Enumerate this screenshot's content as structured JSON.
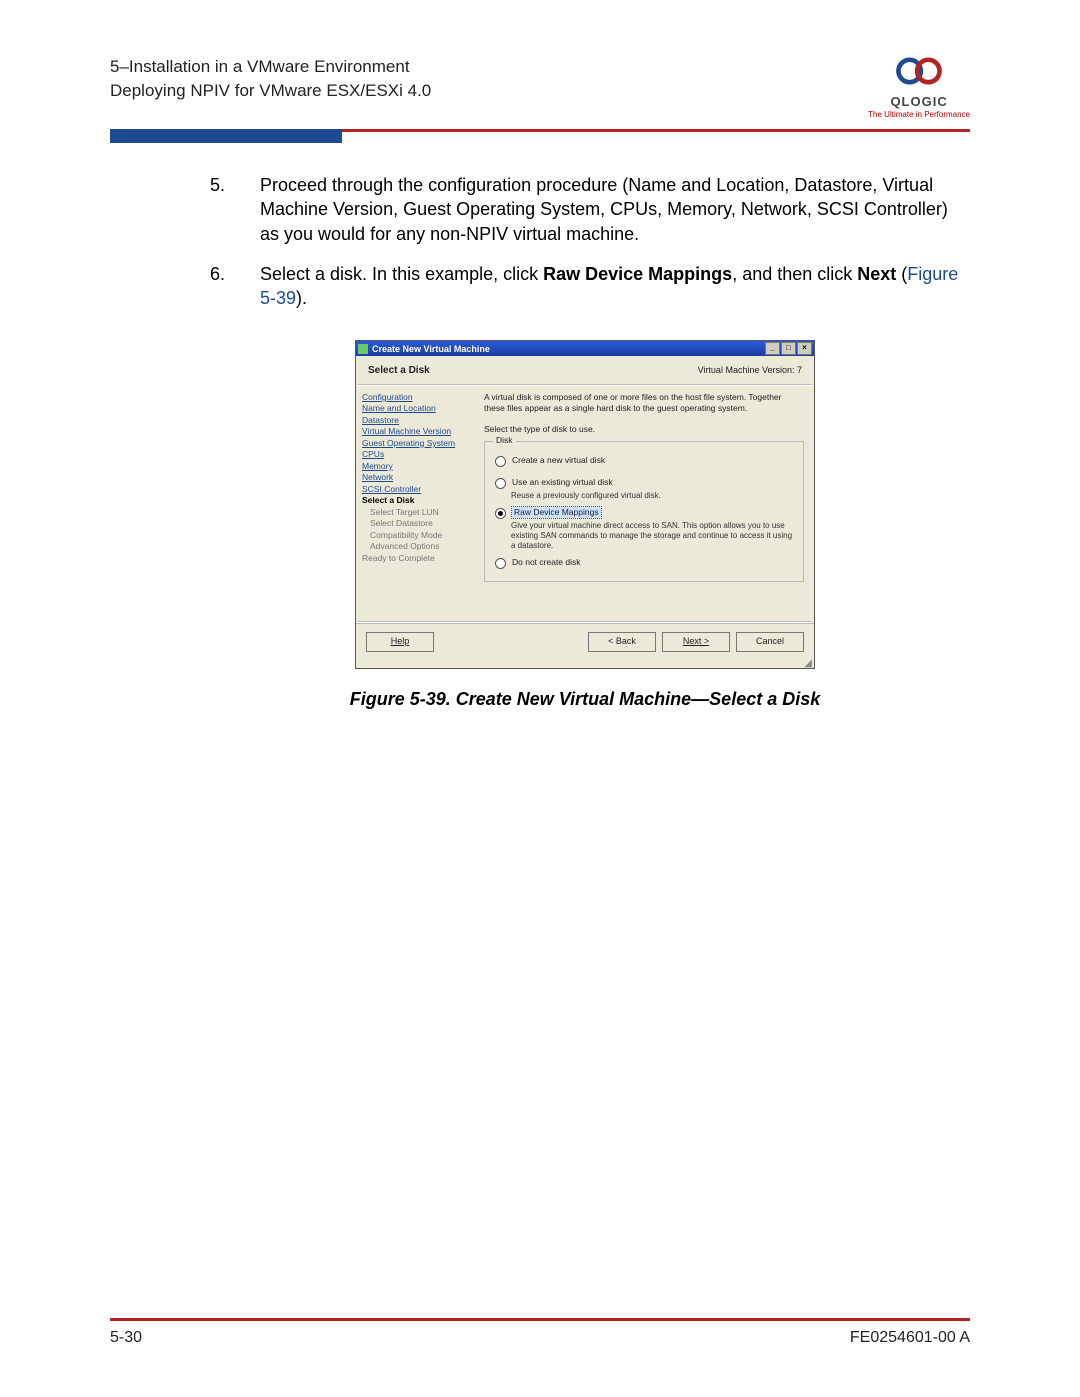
{
  "header": {
    "line1": "5–Installation in a VMware Environment",
    "line2": "Deploying NPIV for VMware ESX/ESXi 4.0",
    "logo_name": "QLOGIC",
    "logo_tag": "The Ultimate in Performance"
  },
  "steps": {
    "s5": {
      "num": "5.",
      "text": "Proceed through the configuration procedure (Name and Location, Datastore, Virtual Machine Version, Guest Operating System, CPUs, Memory, Network, SCSI Controller) as you would for any non-NPIV virtual machine."
    },
    "s6": {
      "num": "6.",
      "pre": "Select a disk. In this example, click ",
      "b1": "Raw Device Mappings",
      "mid": ", and then click ",
      "b2": "Next",
      "post1": " (",
      "figref": "Figure 5-39",
      "post2": ")."
    }
  },
  "win": {
    "title": "Create New Virtual Machine",
    "head_left": "Select a Disk",
    "head_right": "Virtual Machine Version: 7",
    "nav": {
      "configuration": "Configuration",
      "name": "Name and Location",
      "datastore": "Datastore",
      "vmv": "Virtual Machine Version",
      "gos": "Guest Operating System",
      "cpus": "CPUs",
      "memory": "Memory",
      "network": "Network",
      "scsi": "SCSI Controller",
      "select_disk": "Select a Disk",
      "lun": "Select Target LUN",
      "sds": "Select Datastore",
      "comp": "Compatibility Mode",
      "adv": "Advanced Options",
      "ready": "Ready to Complete"
    },
    "panel": {
      "desc": "A virtual disk is composed of one or more files on the host file system. Together these files appear as a single hard disk to the guest operating system.",
      "prompt": "Select the type of disk to use.",
      "group": "Disk",
      "o1": "Create a new virtual disk",
      "o2": "Use an existing virtual disk",
      "o2s": "Reuse a previously configured virtual disk.",
      "o3": "Raw Device Mappings",
      "o3s": "Give your virtual machine direct access to SAN. This option allows you to use existing SAN commands to manage the storage and continue to access it using a datastore.",
      "o4": "Do not create disk"
    },
    "buttons": {
      "help": "Help",
      "back": "< Back",
      "next": "Next >",
      "cancel": "Cancel"
    }
  },
  "caption": "Figure 5-39. Create New Virtual Machine—Select a Disk",
  "footer": {
    "left": "5-30",
    "right": "FE0254601-00 A"
  }
}
